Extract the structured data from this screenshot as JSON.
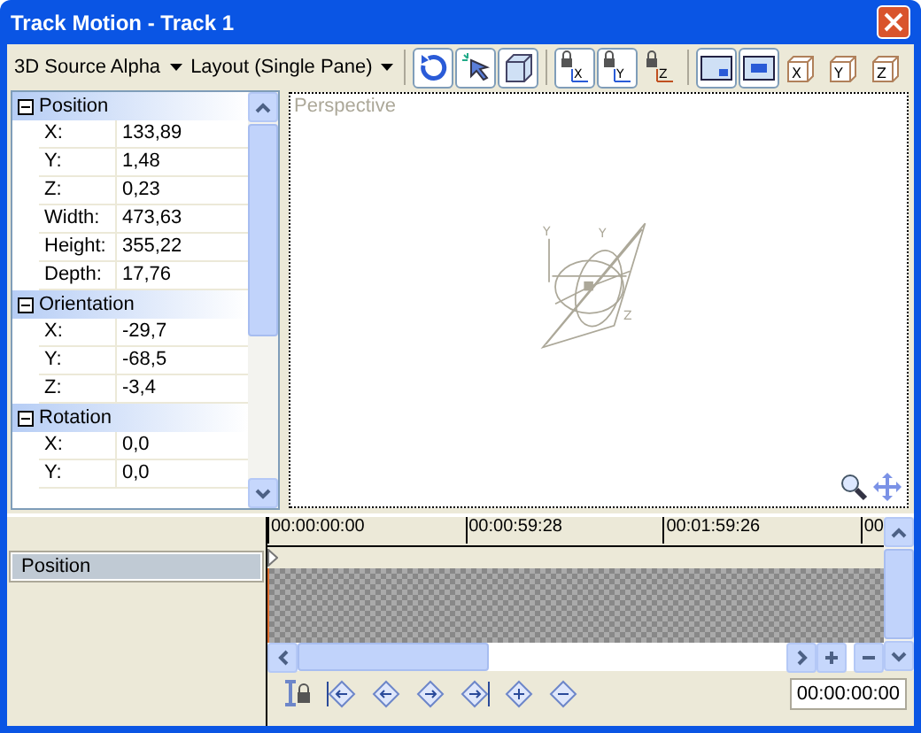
{
  "window": {
    "title": "Track Motion - Track 1"
  },
  "toolbar": {
    "dropdowns": [
      {
        "label": "3D Source Alpha"
      },
      {
        "label": "Layout (Single Pane)"
      }
    ],
    "button_groups": [
      [
        {
          "kind": "rotate",
          "on": true
        },
        {
          "kind": "select",
          "on": true
        },
        {
          "kind": "box",
          "on": true
        }
      ],
      [
        {
          "kind": "lock",
          "label": "X",
          "on": true
        },
        {
          "kind": "lock",
          "label": "Y",
          "on": true
        },
        {
          "kind": "lock",
          "label": "Z",
          "on": false
        }
      ],
      [
        {
          "kind": "screen",
          "on": true
        },
        {
          "kind": "fit",
          "on": true
        },
        {
          "kind": "cube",
          "label": "X",
          "on": false
        },
        {
          "kind": "cube",
          "label": "Y",
          "on": false
        },
        {
          "kind": "cube",
          "label": "Z",
          "on": false
        }
      ]
    ]
  },
  "properties": [
    {
      "name": "Position",
      "expanded": true,
      "children": [
        {
          "label": "X:",
          "value": "133,89"
        },
        {
          "label": "Y:",
          "value": "1,48"
        },
        {
          "label": "Z:",
          "value": "0,23"
        },
        {
          "label": "Width:",
          "value": "473,63"
        },
        {
          "label": "Height:",
          "value": "355,22"
        },
        {
          "label": "Depth:",
          "value": "17,76"
        }
      ]
    },
    {
      "name": "Orientation",
      "expanded": true,
      "children": [
        {
          "label": "X:",
          "value": "-29,7"
        },
        {
          "label": "Y:",
          "value": "-68,5"
        },
        {
          "label": "Z:",
          "value": "-3,4"
        }
      ]
    },
    {
      "name": "Rotation",
      "expanded": true,
      "children": [
        {
          "label": "X:",
          "value": "0,0"
        },
        {
          "label": "Y:",
          "value": "0,0"
        }
      ]
    }
  ],
  "viewport": {
    "label": "Perspective",
    "axis_labels": [
      "Y",
      "Y",
      "Z"
    ]
  },
  "timeline": {
    "ruler": [
      "00:00:00:00",
      "00:00:59:28",
      "00:01:59:26",
      "00"
    ],
    "tracks": [
      {
        "name": "Position",
        "selected": true
      }
    ],
    "buttons": [
      {
        "kind": "lock-cursor"
      },
      {
        "kind": "first"
      },
      {
        "kind": "prev"
      },
      {
        "kind": "next"
      },
      {
        "kind": "last"
      },
      {
        "kind": "add"
      },
      {
        "kind": "remove"
      }
    ],
    "time": "00:00:00:00"
  }
}
